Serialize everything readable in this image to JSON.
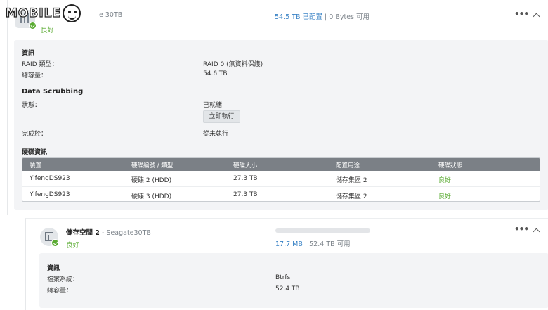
{
  "watermark": {
    "text": "MOBILE"
  },
  "pool": {
    "subtitle_tail": "e 30TB",
    "status": "良好",
    "usage": {
      "used": "54.5 TB 已配置",
      "sep": " | ",
      "free": "0 Bytes 可用"
    },
    "info": {
      "section_title": "資訊",
      "raid_label": "RAID 類型：",
      "raid_value": "RAID 0 (無資料保護)",
      "capacity_label": "總容量：",
      "capacity_value": "54.6 TB"
    },
    "scrubbing": {
      "section_title": "Data Scrubbing",
      "state_label": "狀態：",
      "state_value": "已就緒",
      "run_button": "立即執行",
      "done_label": "完成於：",
      "done_value": "從未執行"
    },
    "disks": {
      "section_title": "硬碟資訊",
      "columns": [
        "裝置",
        "硬碟編號 / 類型",
        "硬碟大小",
        "配置用途",
        "硬碟狀態"
      ],
      "rows": [
        [
          "YifengDS923",
          "硬碟 2 (HDD)",
          "27.3 TB",
          "儲存集區 2",
          "良好"
        ],
        [
          "YifengDS923",
          "硬碟 3 (HDD)",
          "27.3 TB",
          "儲存集區 2",
          "良好"
        ]
      ]
    }
  },
  "volume": {
    "name": "儲存空間 2",
    "sep": " - ",
    "subtitle": "Seagate30TB",
    "status": "良好",
    "usage_fraction": 0.0003,
    "usage": {
      "used": "17.7 MB",
      "sep": " | ",
      "free": "52.4 TB 可用"
    },
    "info": {
      "section_title": "資訊",
      "fs_label": "檔案系統：",
      "fs_value": "Btrfs",
      "capacity_label": "總容量：",
      "capacity_value": "52.4 TB"
    }
  },
  "colors": {
    "accent": "#3a83c6",
    "good": "#5aab32"
  },
  "icons": {
    "pool": "storage-pool-icon",
    "volume": "volume-cube-icon",
    "more": "more-icon",
    "collapse": "chevron-up-icon"
  }
}
